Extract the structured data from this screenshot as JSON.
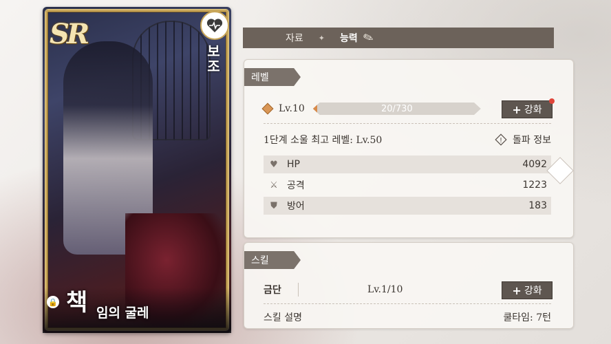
{
  "card": {
    "rarity": "SR",
    "role": "보조",
    "name_big": "책",
    "name_sub": "임의 굴레",
    "icons": {
      "heart": "heart-pulse-icon",
      "lock": "lock-icon"
    }
  },
  "tabs": [
    {
      "label": "자료",
      "active": false
    },
    {
      "label": "능력",
      "active": true
    }
  ],
  "level": {
    "title": "레벨",
    "lv": "Lv.10",
    "exp_text": "20/730",
    "exp_fraction": 0.027,
    "upgrade_label": "강화",
    "max_level_text": "1단계 소울 최고 레벨: Lv.50",
    "breakthrough_label": "돌파 정보",
    "stats": [
      {
        "icon": "heart-icon",
        "label": "HP",
        "value": "4092"
      },
      {
        "icon": "crossed-swords-icon",
        "label": "공격",
        "value": "1223"
      },
      {
        "icon": "shield-icon",
        "label": "방어",
        "value": "183"
      }
    ]
  },
  "skill": {
    "title": "스킬",
    "name": "금단",
    "lv": "Lv.1/10",
    "upgrade_label": "강화",
    "desc_label": "스킬 설명",
    "cooldown": "쿨타임: 7턴"
  },
  "colors": {
    "accent": "#d88a4a",
    "tab_bg": "#6c625a",
    "panel_title": "#7b726b"
  }
}
